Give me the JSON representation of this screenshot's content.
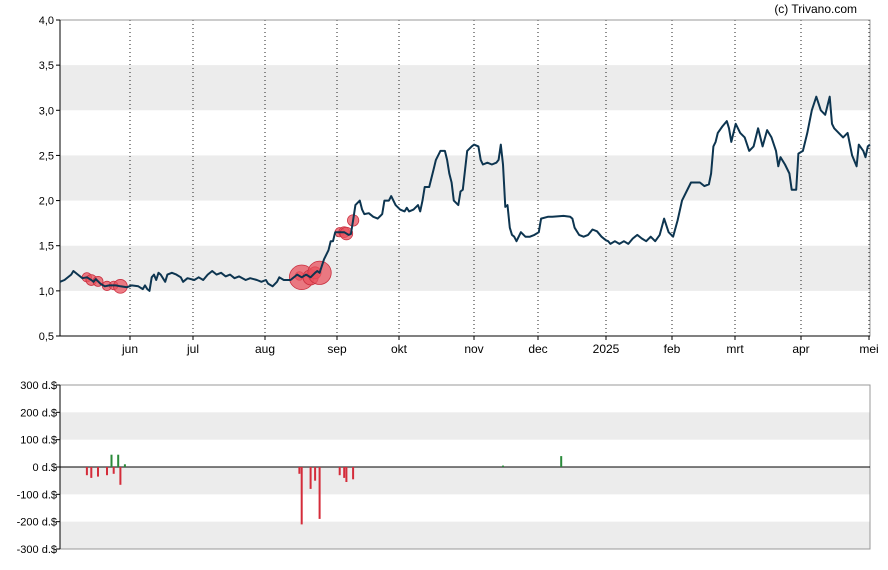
{
  "credit": "(c) Trivano.com",
  "colors": {
    "line": "#0d3550",
    "band": "#ececec",
    "sell": "#d42c3a",
    "buy": "#2a8a3a",
    "bubble": "#e8515d",
    "axis": "#000000"
  },
  "chart_data": [
    {
      "type": "line",
      "ylim": [
        0.5,
        4.0
      ],
      "y_ticks": [
        "0,5",
        "1,0",
        "1,5",
        "2,0",
        "2,5",
        "3,0",
        "3,5",
        "4,0"
      ],
      "x_ticks": [
        "jun",
        "jul",
        "aug",
        "sep",
        "okt",
        "nov",
        "dec",
        "2025",
        "feb",
        "mrt",
        "apr",
        "mei"
      ],
      "x_range_days": [
        0,
        362
      ],
      "series": [
        {
          "points": [
            [
              0,
              1.1
            ],
            [
              2,
              1.12
            ],
            [
              5,
              1.18
            ],
            [
              6,
              1.22
            ],
            [
              8,
              1.18
            ],
            [
              10,
              1.14
            ],
            [
              12,
              1.15
            ],
            [
              14,
              1.12
            ],
            [
              15,
              1.1
            ],
            [
              16,
              1.13
            ],
            [
              18,
              1.08
            ],
            [
              20,
              1.05
            ],
            [
              22,
              1.06
            ],
            [
              25,
              1.06
            ],
            [
              27,
              1.05
            ],
            [
              30,
              1.04
            ],
            [
              32,
              1.06
            ],
            [
              35,
              1.05
            ],
            [
              37,
              1.02
            ],
            [
              38,
              1.06
            ],
            [
              39,
              1.02
            ],
            [
              40,
              1.0
            ],
            [
              41,
              1.15
            ],
            [
              42,
              1.18
            ],
            [
              43,
              1.12
            ],
            [
              44,
              1.2
            ],
            [
              45,
              1.18
            ],
            [
              47,
              1.1
            ],
            [
              48,
              1.18
            ],
            [
              50,
              1.2
            ],
            [
              52,
              1.18
            ],
            [
              54,
              1.15
            ],
            [
              55,
              1.1
            ],
            [
              57,
              1.14
            ],
            [
              60,
              1.12
            ],
            [
              62,
              1.15
            ],
            [
              64,
              1.12
            ],
            [
              66,
              1.18
            ],
            [
              68,
              1.22
            ],
            [
              70,
              1.18
            ],
            [
              72,
              1.2
            ],
            [
              74,
              1.16
            ],
            [
              76,
              1.18
            ],
            [
              78,
              1.14
            ],
            [
              80,
              1.16
            ],
            [
              83,
              1.12
            ],
            [
              85,
              1.14
            ],
            [
              88,
              1.12
            ],
            [
              90,
              1.1
            ],
            [
              92,
              1.12
            ],
            [
              93,
              1.08
            ],
            [
              95,
              1.05
            ],
            [
              97,
              1.1
            ],
            [
              98,
              1.15
            ],
            [
              100,
              1.12
            ],
            [
              103,
              1.12
            ],
            [
              106,
              1.18
            ],
            [
              108,
              1.15
            ],
            [
              110,
              1.18
            ],
            [
              112,
              1.15
            ],
            [
              114,
              1.2
            ],
            [
              115,
              1.22
            ],
            [
              116,
              1.2
            ],
            [
              118,
              1.35
            ],
            [
              120,
              1.45
            ],
            [
              121,
              1.55
            ],
            [
              122,
              1.55
            ],
            [
              123,
              1.65
            ],
            [
              125,
              1.65
            ],
            [
              127,
              1.65
            ],
            [
              129,
              1.62
            ],
            [
              130,
              1.63
            ],
            [
              131,
              1.78
            ],
            [
              132,
              1.95
            ],
            [
              134,
              2.0
            ],
            [
              135,
              1.9
            ],
            [
              136,
              1.85
            ],
            [
              138,
              1.86
            ],
            [
              140,
              1.82
            ],
            [
              142,
              1.8
            ],
            [
              144,
              1.85
            ],
            [
              145,
              2.0
            ],
            [
              147,
              2.0
            ],
            [
              148,
              2.05
            ],
            [
              150,
              1.95
            ],
            [
              152,
              1.9
            ],
            [
              154,
              1.88
            ],
            [
              155,
              1.92
            ],
            [
              156,
              1.88
            ],
            [
              158,
              1.9
            ],
            [
              160,
              1.95
            ],
            [
              161,
              1.88
            ],
            [
              162,
              2.0
            ],
            [
              163,
              2.15
            ],
            [
              165,
              2.15
            ],
            [
              167,
              2.35
            ],
            [
              168,
              2.45
            ],
            [
              170,
              2.55
            ],
            [
              172,
              2.55
            ],
            [
              173,
              2.45
            ],
            [
              174,
              2.3
            ],
            [
              175,
              2.2
            ],
            [
              176,
              2.0
            ],
            [
              178,
              1.95
            ],
            [
              179,
              2.1
            ],
            [
              180,
              2.12
            ],
            [
              182,
              2.55
            ],
            [
              184,
              2.6
            ],
            [
              185,
              2.62
            ],
            [
              187,
              2.6
            ],
            [
              188,
              2.45
            ],
            [
              189,
              2.4
            ],
            [
              191,
              2.42
            ],
            [
              193,
              2.4
            ],
            [
              195,
              2.42
            ],
            [
              196,
              2.45
            ],
            [
              197,
              2.62
            ],
            [
              198,
              2.4
            ],
            [
              199,
              1.93
            ],
            [
              200,
              1.95
            ],
            [
              201,
              1.7
            ],
            [
              202,
              1.62
            ],
            [
              203,
              1.6
            ],
            [
              204,
              1.55
            ],
            [
              206,
              1.65
            ],
            [
              208,
              1.6
            ],
            [
              210,
              1.6
            ],
            [
              212,
              1.62
            ],
            [
              214,
              1.65
            ],
            [
              215,
              1.8
            ],
            [
              218,
              1.82
            ],
            [
              220,
              1.82
            ],
            [
              225,
              1.83
            ],
            [
              228,
              1.82
            ],
            [
              229,
              1.8
            ],
            [
              230,
              1.7
            ],
            [
              232,
              1.62
            ],
            [
              234,
              1.6
            ],
            [
              236,
              1.62
            ],
            [
              238,
              1.68
            ],
            [
              240,
              1.66
            ],
            [
              242,
              1.6
            ],
            [
              244,
              1.56
            ],
            [
              245,
              1.55
            ],
            [
              246,
              1.52
            ],
            [
              248,
              1.55
            ],
            [
              250,
              1.52
            ],
            [
              252,
              1.55
            ],
            [
              254,
              1.52
            ],
            [
              256,
              1.58
            ],
            [
              258,
              1.62
            ],
            [
              260,
              1.58
            ],
            [
              262,
              1.55
            ],
            [
              264,
              1.6
            ],
            [
              266,
              1.55
            ],
            [
              268,
              1.62
            ],
            [
              270,
              1.8
            ],
            [
              272,
              1.65
            ],
            [
              274,
              1.6
            ],
            [
              276,
              1.78
            ],
            [
              278,
              2.0
            ],
            [
              280,
              2.1
            ],
            [
              282,
              2.2
            ],
            [
              284,
              2.2
            ],
            [
              286,
              2.2
            ],
            [
              288,
              2.16
            ],
            [
              290,
              2.18
            ],
            [
              291,
              2.3
            ],
            [
              292,
              2.6
            ],
            [
              293,
              2.65
            ],
            [
              294,
              2.75
            ],
            [
              296,
              2.82
            ],
            [
              298,
              2.88
            ],
            [
              299,
              2.8
            ],
            [
              300,
              2.65
            ],
            [
              302,
              2.85
            ],
            [
              304,
              2.75
            ],
            [
              306,
              2.7
            ],
            [
              308,
              2.55
            ],
            [
              310,
              2.6
            ],
            [
              312,
              2.8
            ],
            [
              314,
              2.6
            ],
            [
              316,
              2.78
            ],
            [
              318,
              2.7
            ],
            [
              320,
              2.55
            ],
            [
              321,
              2.38
            ],
            [
              322,
              2.48
            ],
            [
              324,
              2.4
            ],
            [
              326,
              2.3
            ],
            [
              327,
              2.12
            ],
            [
              329,
              2.12
            ],
            [
              330,
              2.52
            ],
            [
              332,
              2.55
            ],
            [
              334,
              2.75
            ],
            [
              336,
              3.0
            ],
            [
              338,
              3.15
            ],
            [
              340,
              3.0
            ],
            [
              342,
              2.95
            ],
            [
              344,
              3.15
            ],
            [
              345,
              2.85
            ],
            [
              346,
              2.8
            ],
            [
              348,
              2.75
            ],
            [
              350,
              2.7
            ],
            [
              352,
              2.75
            ],
            [
              354,
              2.5
            ],
            [
              356,
              2.38
            ],
            [
              357,
              2.62
            ],
            [
              359,
              2.55
            ],
            [
              360,
              2.48
            ],
            [
              361,
              2.6
            ],
            [
              362,
              2.62
            ]
          ]
        }
      ]
    },
    {
      "type": "bar",
      "ylim": [
        -300,
        300
      ],
      "y_ticks": [
        "-300 d.$",
        "-200 d.$",
        "-100 d.$",
        "0 d.$",
        "100 d.$",
        "200 d.$",
        "300 d.$"
      ],
      "values_days": [
        [
          12,
          -30
        ],
        [
          14,
          -40
        ],
        [
          17,
          -35
        ],
        [
          21,
          -30
        ],
        [
          23,
          45
        ],
        [
          24,
          -25
        ],
        [
          26,
          45
        ],
        [
          27,
          -65
        ],
        [
          29,
          10
        ],
        [
          107,
          -25
        ],
        [
          108,
          -210
        ],
        [
          112,
          -80
        ],
        [
          114,
          -50
        ],
        [
          116,
          -190
        ],
        [
          125,
          -30
        ],
        [
          127,
          -40
        ],
        [
          128,
          -55
        ],
        [
          131,
          -45
        ],
        [
          198,
          5
        ],
        [
          224,
          40
        ]
      ]
    }
  ]
}
